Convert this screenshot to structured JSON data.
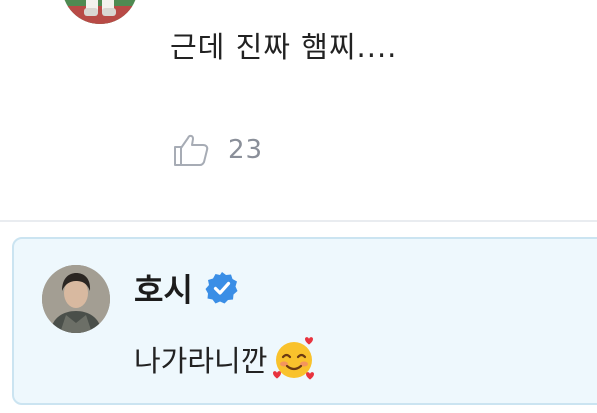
{
  "comment": {
    "text": "근데 진짜 햄찌....",
    "likes": "23",
    "avatar_icon": "user-avatar-icon",
    "like_icon": "thumbs-up-icon"
  },
  "reply": {
    "author": "호시",
    "verified_icon": "verified-badge-icon",
    "text": "나가라니깐",
    "emoji_icon": "smiling-face-with-hearts-icon",
    "avatar_icon": "artist-avatar-icon"
  },
  "colors": {
    "reply_background": "#eef8fd",
    "reply_border": "#cbe4f1",
    "verified_blue": "#3a8ee6",
    "muted_text": "#8a8f99",
    "divider": "#e9ecf0"
  }
}
